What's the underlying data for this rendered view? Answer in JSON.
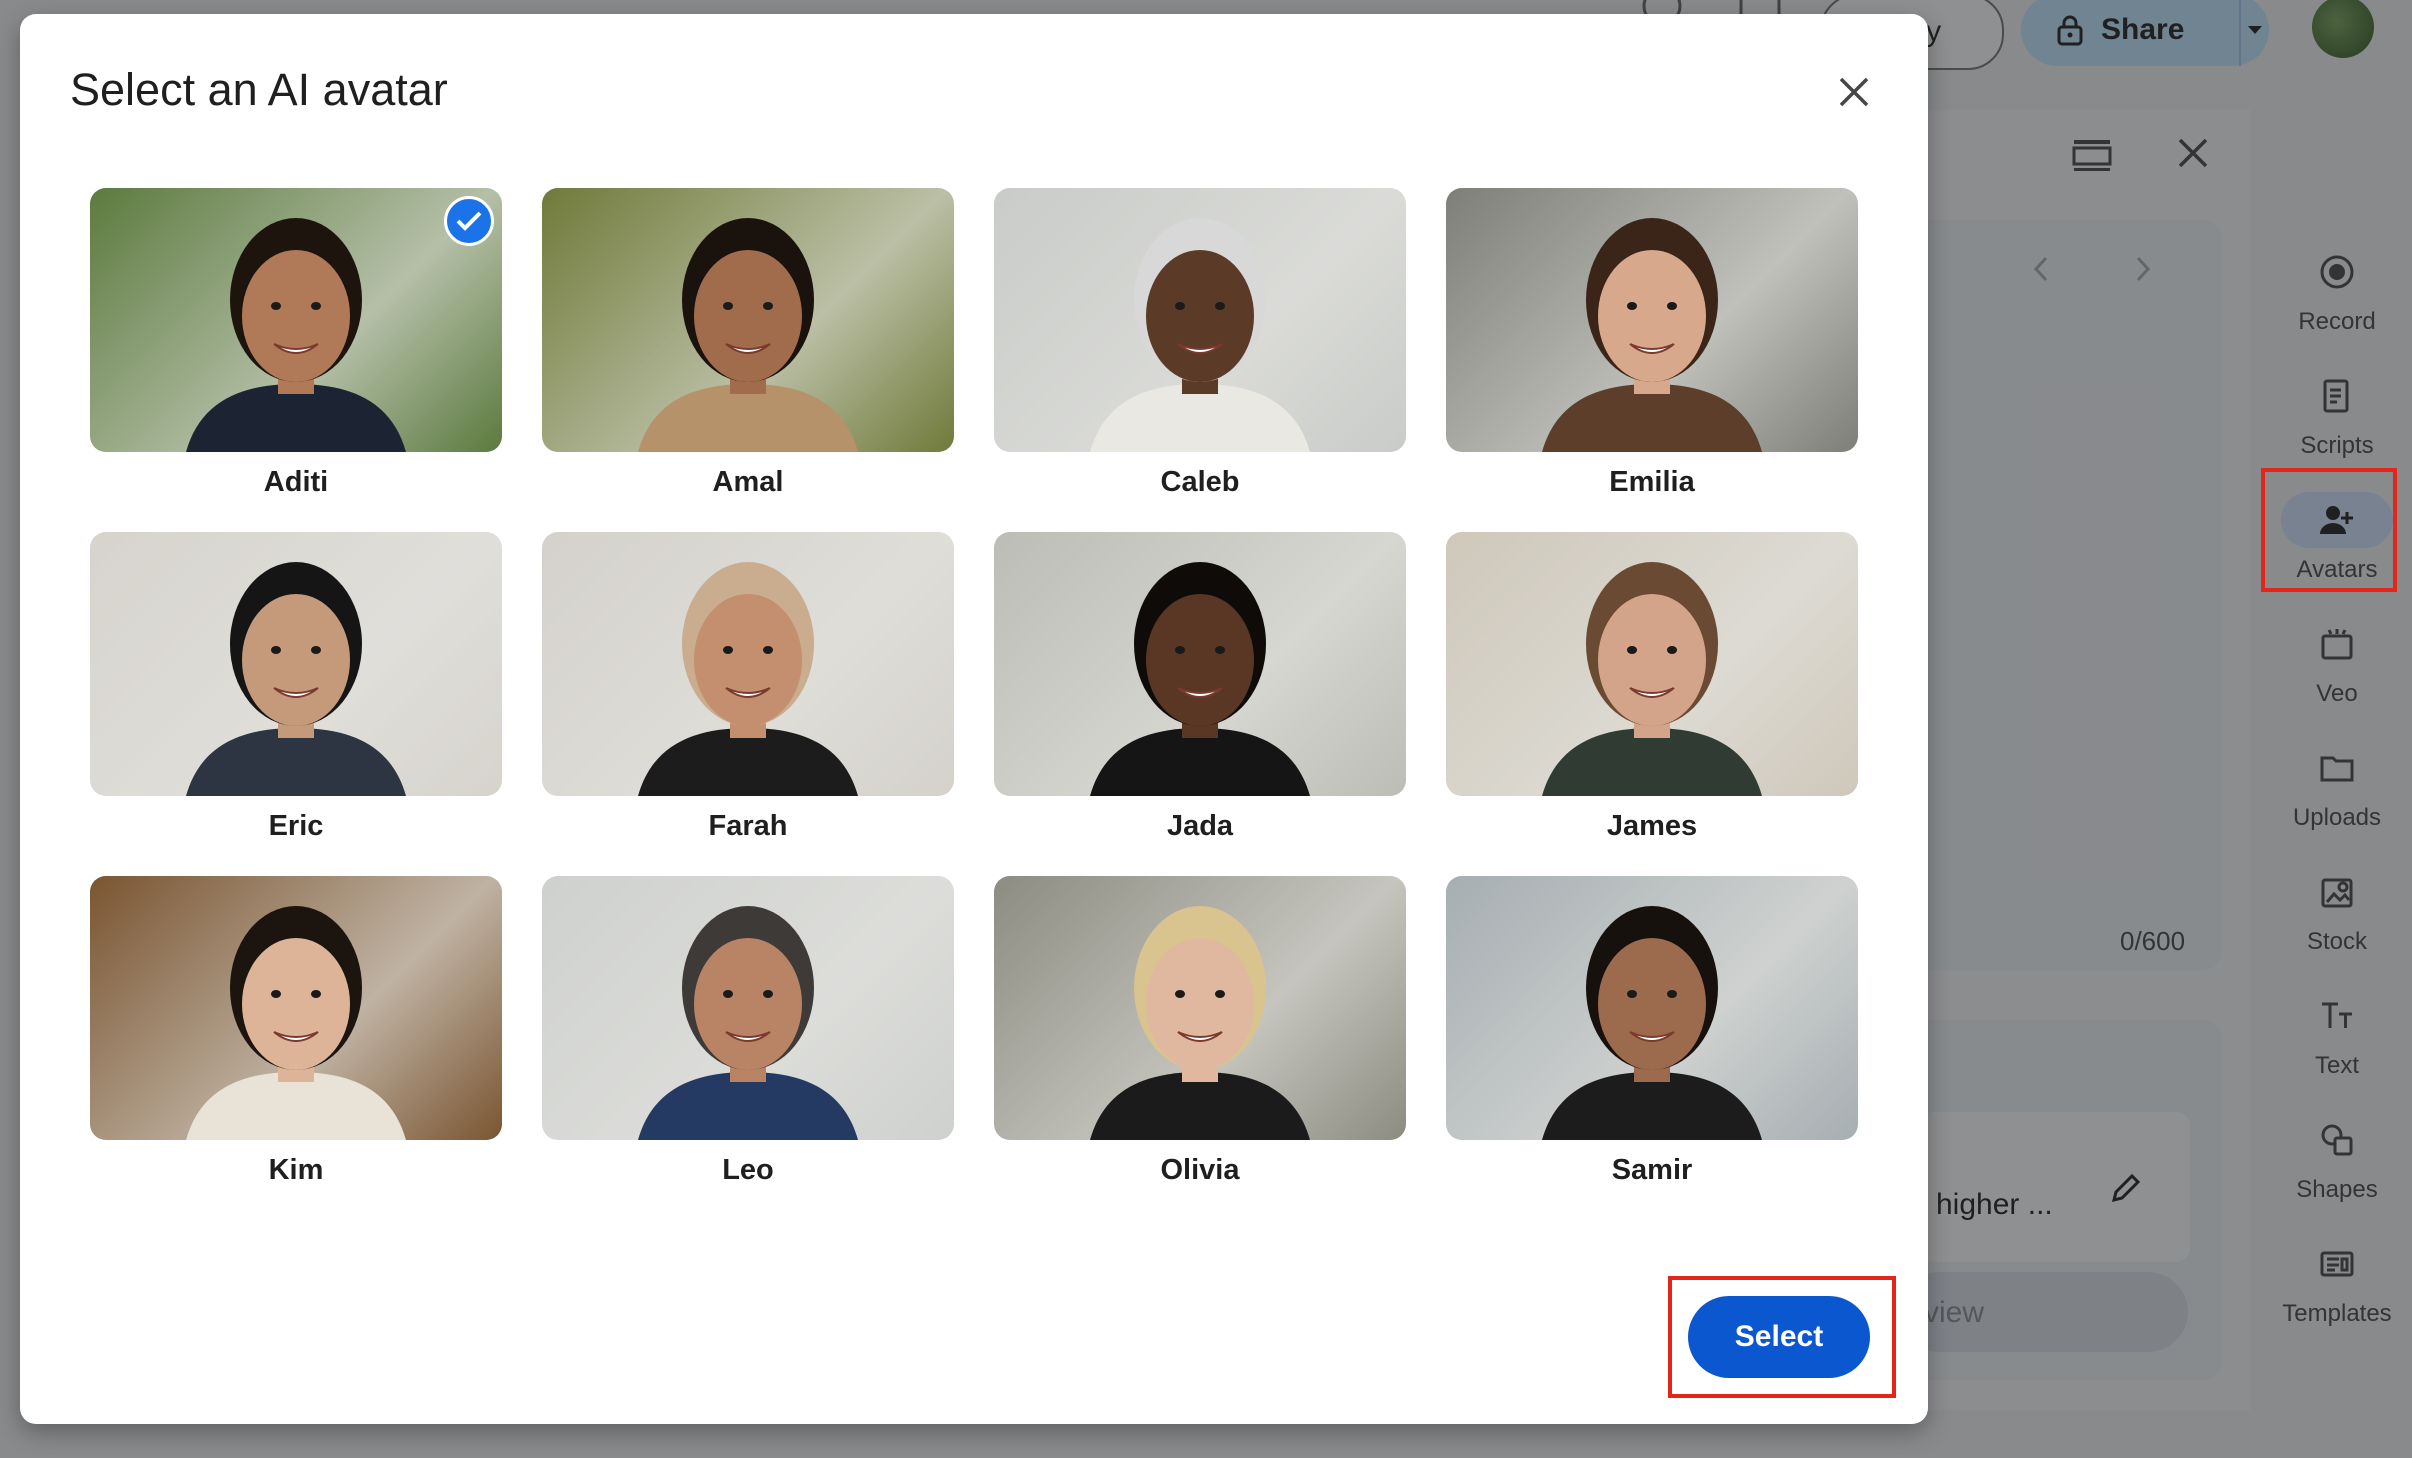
{
  "topbar": {
    "play_label": "Play",
    "share_label": "Share"
  },
  "panel": {
    "counter": "0/600",
    "suggestion_text": "higher ...",
    "preview_label": "view"
  },
  "rail": {
    "items": [
      {
        "label": "Record",
        "icon": "record-icon"
      },
      {
        "label": "Scripts",
        "icon": "scripts-icon"
      },
      {
        "label": "Avatars",
        "icon": "avatars-icon",
        "active": true
      },
      {
        "label": "Veo",
        "icon": "veo-icon"
      },
      {
        "label": "Uploads",
        "icon": "folder-icon"
      },
      {
        "label": "Stock",
        "icon": "stock-icon"
      },
      {
        "label": "Text",
        "icon": "text-icon"
      },
      {
        "label": "Shapes",
        "icon": "shapes-icon"
      },
      {
        "label": "Templates",
        "icon": "templates-icon"
      }
    ]
  },
  "modal": {
    "title": "Select an AI avatar",
    "select_label": "Select",
    "avatars": [
      {
        "name": "Aditi",
        "selected": true,
        "bg": "#5d7a3f",
        "skin": "#b07a58",
        "hair": "#1e140e",
        "shirt": "#1c2433"
      },
      {
        "name": "Amal",
        "selected": false,
        "bg": "#6f7a3a",
        "skin": "#a06c4c",
        "hair": "#1a120c",
        "shirt": "#b6926a"
      },
      {
        "name": "Caleb",
        "selected": false,
        "bg": "#c9ccc9",
        "skin": "#5b3a28",
        "hair": "#d8d8d8",
        "shirt": "#eae8e2"
      },
      {
        "name": "Emilia",
        "selected": false,
        "bg": "#7d7f78",
        "skin": "#d7a88c",
        "hair": "#3b2518",
        "shirt": "#5c3e2a"
      },
      {
        "name": "Eric",
        "selected": false,
        "bg": "#d7d4cd",
        "skin": "#c59a7a",
        "hair": "#151515",
        "shirt": "#2d3442"
      },
      {
        "name": "Farah",
        "selected": false,
        "bg": "#d5d2cc",
        "skin": "#c48f6e",
        "hair": "#c9ad8e",
        "shirt": "#1c1c1c"
      },
      {
        "name": "Jada",
        "selected": false,
        "bg": "#bdbdb7",
        "skin": "#5a3724",
        "hair": "#0f0b09",
        "shirt": "#151515"
      },
      {
        "name": "James",
        "selected": false,
        "bg": "#cfc8bb",
        "skin": "#d4a48a",
        "hair": "#6a4a33",
        "shirt": "#2f3b33"
      },
      {
        "name": "Kim",
        "selected": false,
        "bg": "#7a5532",
        "skin": "#ddb497",
        "hair": "#1c140e",
        "shirt": "#e9e2d6"
      },
      {
        "name": "Leo",
        "selected": false,
        "bg": "#cfd1cf",
        "skin": "#b98466",
        "hair": "#3d3a38",
        "shirt": "#253a63"
      },
      {
        "name": "Olivia",
        "selected": false,
        "bg": "#8c8c82",
        "skin": "#e0b8a0",
        "hair": "#d9c38f",
        "shirt": "#1b1b1b"
      },
      {
        "name": "Samir",
        "selected": false,
        "bg": "#a7aeb2",
        "skin": "#9c6a4c",
        "hair": "#17110d",
        "shirt": "#1c1c1c"
      }
    ]
  },
  "colors": {
    "primary": "#0b57d0",
    "highlight": "#e2261b"
  }
}
